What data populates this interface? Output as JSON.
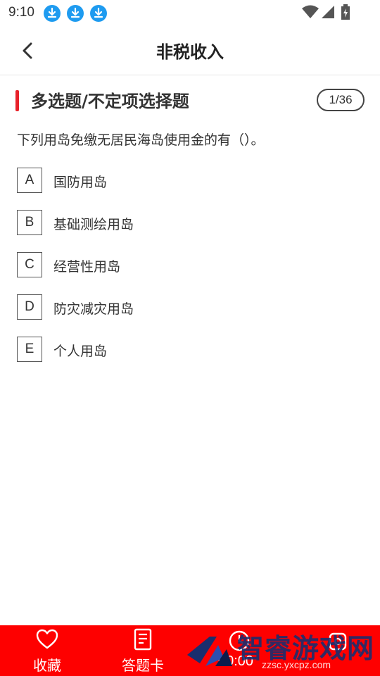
{
  "status_bar": {
    "time": "9:10"
  },
  "header": {
    "title": "非税收入"
  },
  "question": {
    "type_label": "多选题/不定项选择题",
    "progress": "1/36",
    "text": "下列用岛免缴无居民海岛使用金的有（）。",
    "options": [
      {
        "letter": "A",
        "text": "国防用岛"
      },
      {
        "letter": "B",
        "text": "基础测绘用岛"
      },
      {
        "letter": "C",
        "text": "经营性用岛"
      },
      {
        "letter": "D",
        "text": "防灾减灾用岛"
      },
      {
        "letter": "E",
        "text": "个人用岛"
      }
    ]
  },
  "bottom_bar": {
    "favorite_label": "收藏",
    "answer_card_label": "答题卡",
    "timer": "00:00"
  },
  "watermark": {
    "text": "智睿游戏网",
    "url": "zzsc.yxcpz.com"
  },
  "colors": {
    "accent": "#fe0000",
    "download_icon": "#1e9bf0",
    "type_bar": "#e8222a"
  },
  "icons": [
    "download-icon",
    "wifi-icon",
    "signal-icon",
    "battery-icon",
    "back-arrow-icon",
    "heart-icon",
    "answer-card-icon",
    "clock-icon",
    "settings-icon"
  ]
}
